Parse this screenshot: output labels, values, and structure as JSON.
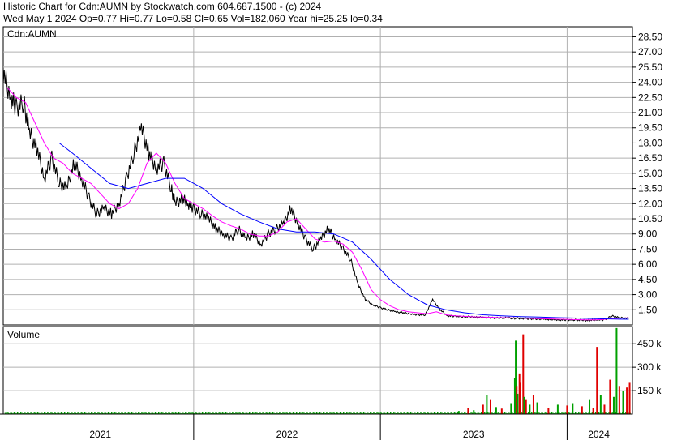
{
  "header": {
    "line1": "Historic Chart for Cdn:AUMN by Stockwatch.com 604.687.1500 - (c) 2024",
    "line2": "Wed May  1 2024  Op=0.77  Hi=0.77  Lo=0.58  Cl=0.65  Vol=182,060  Year hi=25.25  lo=0.34"
  },
  "colors": {
    "price": "#000000",
    "ma_short": "#ff00ff",
    "ma_long": "#0000ff",
    "vol_up": "#00a000",
    "vol_down": "#e00000",
    "grid": "#b0b0b0"
  },
  "chart_data": [
    {
      "type": "line",
      "title": "Cdn:AUMN",
      "ylim": [
        0,
        29.5
      ],
      "y_ticks": [
        "28.50",
        "27.00",
        "25.50",
        "24.00",
        "22.50",
        "21.00",
        "19.50",
        "18.00",
        "16.50",
        "15.00",
        "13.50",
        "12.00",
        "10.50",
        "9.00",
        "7.50",
        "6.00",
        "4.50",
        "3.00",
        "1.50"
      ],
      "y_tick_values": [
        28.5,
        27,
        25.5,
        24,
        22.5,
        21,
        19.5,
        18,
        16.5,
        15,
        13.5,
        12,
        10.5,
        9,
        7.5,
        6,
        4.5,
        3,
        1.5
      ],
      "x_range": [
        2020.98,
        2024.35
      ],
      "x_labels": [
        "2021",
        "2022",
        "2023",
        "2024"
      ],
      "x_label_positions": [
        2021.5,
        2022.5,
        2023.5,
        2024.17
      ],
      "x_dividers": [
        2022.0,
        2023.0,
        2024.0
      ],
      "series": [
        {
          "key": "price",
          "x": [
            2020.98,
            2021.02,
            2021.05,
            2021.09,
            2021.12,
            2021.16,
            2021.2,
            2021.24,
            2021.28,
            2021.32,
            2021.36,
            2021.4,
            2021.44,
            2021.48,
            2021.52,
            2021.56,
            2021.6,
            2021.64,
            2021.68,
            2021.72,
            2021.76,
            2021.8,
            2021.84,
            2021.88,
            2021.9,
            2021.94,
            2021.97,
            2022.0,
            2022.04,
            2022.08,
            2022.12,
            2022.16,
            2022.2,
            2022.24,
            2022.28,
            2022.32,
            2022.36,
            2022.4,
            2022.44,
            2022.48,
            2022.52,
            2022.56,
            2022.6,
            2022.64,
            2022.68,
            2022.72,
            2022.76,
            2022.8,
            2022.84,
            2022.88,
            2022.92,
            2022.96,
            2023.0,
            2023.04,
            2023.08,
            2023.12,
            2023.16,
            2023.2,
            2023.24,
            2023.28,
            2023.32,
            2023.36,
            2023.4,
            2023.44,
            2023.48,
            2023.52,
            2023.56,
            2023.6,
            2023.64,
            2023.68,
            2023.72,
            2023.76,
            2023.8,
            2023.84,
            2023.88,
            2023.92,
            2023.96,
            2024.0,
            2024.04,
            2024.08,
            2024.12,
            2024.16,
            2024.2,
            2024.24,
            2024.28,
            2024.33
          ],
          "y": [
            25.0,
            22.5,
            21.5,
            22.0,
            19.0,
            17.5,
            14.5,
            16.5,
            14.0,
            13.5,
            16.0,
            14.5,
            12.5,
            11.0,
            11.5,
            11.0,
            12.0,
            14.5,
            17.0,
            19.5,
            17.0,
            15.5,
            16.0,
            13.5,
            12.0,
            12.5,
            12.0,
            11.5,
            11.0,
            10.5,
            9.5,
            9.0,
            8.5,
            9.5,
            8.5,
            9.0,
            8.0,
            9.0,
            9.5,
            10.0,
            11.5,
            10.0,
            8.5,
            7.5,
            8.5,
            9.5,
            8.5,
            7.5,
            6.5,
            4.0,
            2.5,
            2.0,
            1.7,
            1.5,
            1.3,
            1.2,
            1.1,
            1.0,
            1.0,
            2.5,
            1.5,
            0.9,
            0.85,
            0.8,
            0.8,
            0.75,
            0.75,
            0.7,
            0.7,
            0.7,
            0.65,
            0.65,
            0.6,
            0.6,
            0.55,
            0.55,
            0.5,
            0.5,
            0.5,
            0.45,
            0.45,
            0.5,
            0.5,
            0.9,
            0.7,
            0.65
          ]
        },
        {
          "key": "ma_short",
          "x": [
            2021.0,
            2021.05,
            2021.1,
            2021.15,
            2021.2,
            2021.25,
            2021.3,
            2021.35,
            2021.4,
            2021.45,
            2021.5,
            2021.55,
            2021.6,
            2021.65,
            2021.7,
            2021.75,
            2021.8,
            2021.85,
            2021.9,
            2021.95,
            2022.0,
            2022.05,
            2022.1,
            2022.15,
            2022.2,
            2022.25,
            2022.3,
            2022.35,
            2022.4,
            2022.45,
            2022.5,
            2022.55,
            2022.6,
            2022.65,
            2022.7,
            2022.75,
            2022.8,
            2022.85,
            2022.9,
            2022.95,
            2023.0,
            2023.05,
            2023.1,
            2023.15,
            2023.2,
            2023.25,
            2023.3,
            2023.35,
            2023.4,
            2023.45,
            2023.5,
            2023.55,
            2023.6,
            2023.65,
            2023.7,
            2023.75,
            2023.8,
            2023.85,
            2023.9,
            2023.95,
            2024.0,
            2024.05,
            2024.1,
            2024.15,
            2024.2,
            2024.25,
            2024.33
          ],
          "y": [
            23.5,
            22.5,
            22.0,
            20.0,
            18.0,
            16.5,
            16.0,
            15.0,
            14.5,
            14.0,
            13.0,
            12.0,
            11.5,
            12.0,
            13.5,
            16.0,
            17.0,
            16.0,
            14.0,
            12.5,
            12.0,
            11.5,
            10.8,
            10.2,
            9.8,
            9.5,
            9.0,
            8.8,
            8.8,
            9.2,
            10.2,
            10.5,
            9.5,
            8.5,
            8.2,
            8.3,
            8.0,
            7.2,
            5.5,
            3.5,
            2.5,
            1.9,
            1.5,
            1.3,
            1.2,
            1.1,
            1.3,
            1.0,
            0.9,
            0.85,
            0.8,
            0.78,
            0.75,
            0.72,
            0.7,
            0.68,
            0.65,
            0.62,
            0.6,
            0.57,
            0.55,
            0.52,
            0.5,
            0.5,
            0.55,
            0.65,
            0.7
          ]
        },
        {
          "key": "ma_long",
          "x": [
            2021.28,
            2021.35,
            2021.45,
            2021.55,
            2021.65,
            2021.75,
            2021.85,
            2021.95,
            2022.05,
            2022.15,
            2022.25,
            2022.35,
            2022.45,
            2022.55,
            2022.65,
            2022.75,
            2022.85,
            2022.95,
            2023.05,
            2023.15,
            2023.25,
            2023.35,
            2023.45,
            2023.55,
            2023.65,
            2023.75,
            2023.85,
            2023.95,
            2024.05,
            2024.15,
            2024.25,
            2024.33
          ],
          "y": [
            18.0,
            17.0,
            15.5,
            14.0,
            13.5,
            14.0,
            14.5,
            14.5,
            13.5,
            12.0,
            11.0,
            10.2,
            9.5,
            9.2,
            9.2,
            9.0,
            8.2,
            6.5,
            4.5,
            3.0,
            2.0,
            1.5,
            1.2,
            1.0,
            0.9,
            0.82,
            0.78,
            0.72,
            0.68,
            0.62,
            0.58,
            0.56
          ]
        }
      ]
    },
    {
      "type": "bar",
      "title": "Volume",
      "ylim": [
        0,
        560
      ],
      "y_ticks": [
        "450 k",
        "300 k",
        "150 k"
      ],
      "y_tick_values": [
        450,
        300,
        150
      ],
      "x_range": [
        2020.98,
        2024.35
      ],
      "spikes": [
        {
          "x": 2023.42,
          "v": 20,
          "up": true
        },
        {
          "x": 2023.47,
          "v": 40,
          "up": false
        },
        {
          "x": 2023.5,
          "v": 25,
          "up": true
        },
        {
          "x": 2023.55,
          "v": 60,
          "up": false
        },
        {
          "x": 2023.57,
          "v": 120,
          "up": true
        },
        {
          "x": 2023.59,
          "v": 90,
          "up": false
        },
        {
          "x": 2023.62,
          "v": 45,
          "up": true
        },
        {
          "x": 2023.65,
          "v": 35,
          "up": false
        },
        {
          "x": 2023.7,
          "v": 70,
          "up": true
        },
        {
          "x": 2023.72,
          "v": 230,
          "up": true
        },
        {
          "x": 2023.725,
          "v": 470,
          "up": true
        },
        {
          "x": 2023.73,
          "v": 180,
          "up": false
        },
        {
          "x": 2023.735,
          "v": 130,
          "up": true
        },
        {
          "x": 2023.745,
          "v": 260,
          "up": false
        },
        {
          "x": 2023.75,
          "v": 200,
          "up": false
        },
        {
          "x": 2023.765,
          "v": 510,
          "up": false
        },
        {
          "x": 2023.77,
          "v": 110,
          "up": true
        },
        {
          "x": 2023.78,
          "v": 90,
          "up": false
        },
        {
          "x": 2023.8,
          "v": 60,
          "up": true
        },
        {
          "x": 2023.82,
          "v": 120,
          "up": false
        },
        {
          "x": 2023.84,
          "v": 75,
          "up": true
        },
        {
          "x": 2023.9,
          "v": 40,
          "up": false
        },
        {
          "x": 2023.95,
          "v": 60,
          "up": true
        },
        {
          "x": 2024.0,
          "v": 55,
          "up": false
        },
        {
          "x": 2024.03,
          "v": 70,
          "up": true
        },
        {
          "x": 2024.08,
          "v": 50,
          "up": false
        },
        {
          "x": 2024.12,
          "v": 90,
          "up": true
        },
        {
          "x": 2024.14,
          "v": 40,
          "up": false
        },
        {
          "x": 2024.16,
          "v": 430,
          "up": false
        },
        {
          "x": 2024.18,
          "v": 120,
          "up": true
        },
        {
          "x": 2024.2,
          "v": 60,
          "up": false
        },
        {
          "x": 2024.23,
          "v": 220,
          "up": false
        },
        {
          "x": 2024.25,
          "v": 110,
          "up": true
        },
        {
          "x": 2024.265,
          "v": 550,
          "up": true
        },
        {
          "x": 2024.28,
          "v": 180,
          "up": false
        },
        {
          "x": 2024.3,
          "v": 150,
          "up": true
        },
        {
          "x": 2024.32,
          "v": 170,
          "up": false
        },
        {
          "x": 2024.335,
          "v": 200,
          "up": false
        }
      ]
    }
  ]
}
